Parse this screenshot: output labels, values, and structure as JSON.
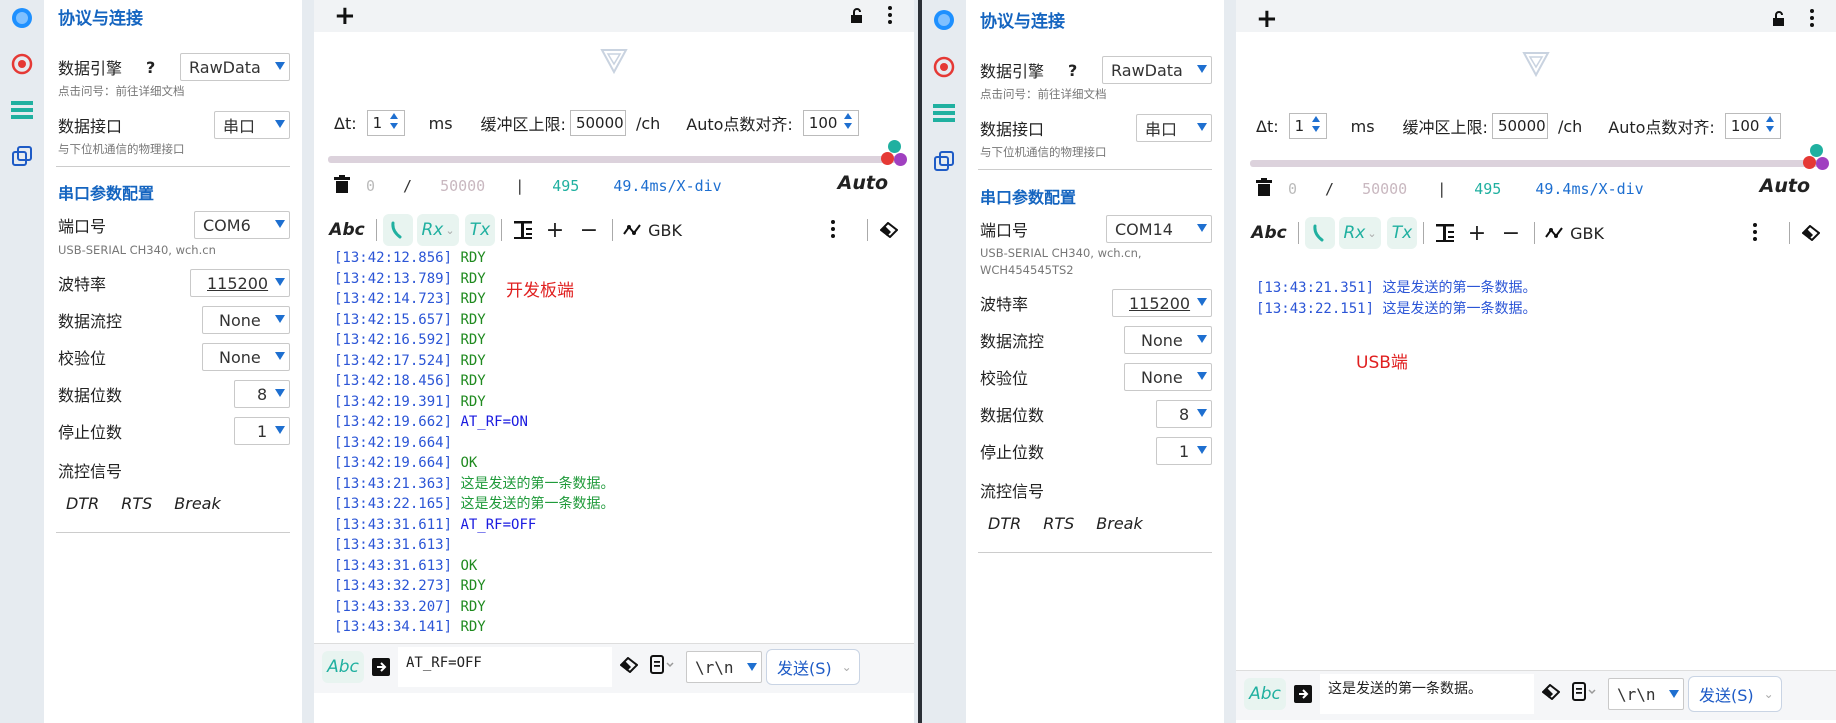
{
  "left": {
    "panel": {
      "section_title": "协议与连接",
      "engine_label": "数据引擎",
      "engine_help": "?",
      "engine_value": "RawData",
      "engine_hint": "点击问号：前往详细文档",
      "iface_label": "数据接口",
      "iface_value": "串口",
      "iface_hint": "与下位机通信的物理接口",
      "serial_title": "串口参数配置",
      "port_label": "端口号",
      "port_value": "COM6",
      "port_hint": "USB-SERIAL CH340, wch.cn",
      "baud_label": "波特率",
      "baud_value": "115200",
      "flow_label": "数据流控",
      "flow_value": "None",
      "parity_label": "校验位",
      "parity_value": "None",
      "databits_label": "数据位数",
      "databits_value": "8",
      "stopbits_label": "停止位数",
      "stopbits_value": "1",
      "flowsig_label": "流控信号",
      "dtr": "DTR",
      "rts": "RTS",
      "brk": "Break"
    },
    "main": {
      "add": "+",
      "dt_label": "Δt:",
      "dt_value": "1",
      "dt_unit": "ms",
      "buf_label": "缓冲区上限:",
      "buf_value": "50000",
      "buf_unit": "/ch",
      "align_label": "Auto点数对齐:",
      "align_value": "100",
      "stat_count": "0",
      "stat_slash": "/",
      "stat_max": "50000",
      "stat_bar": "|",
      "stat_n": "495",
      "stat_div": "49.4ms/X-div",
      "auto": "Auto",
      "tb_abc": "Abc",
      "tb_rx": "Rx",
      "tb_tx": "Tx",
      "tb_plus": "+",
      "tb_minus": "−",
      "tb_enc": "GBK",
      "annotation": "开发板端",
      "log": [
        {
          "t": "[13:42:12.856]",
          "m": "RDY",
          "c": "tx-green"
        },
        {
          "t": "[13:42:13.789]",
          "m": "RDY",
          "c": "tx-green"
        },
        {
          "t": "[13:42:14.723]",
          "m": "RDY",
          "c": "tx-green"
        },
        {
          "t": "[13:42:15.657]",
          "m": "RDY",
          "c": "tx-green"
        },
        {
          "t": "[13:42:16.592]",
          "m": "RDY",
          "c": "tx-green"
        },
        {
          "t": "[13:42:17.524]",
          "m": "RDY",
          "c": "tx-green"
        },
        {
          "t": "[13:42:18.456]",
          "m": "RDY",
          "c": "tx-green"
        },
        {
          "t": "[13:42:19.391]",
          "m": "RDY",
          "c": "tx-green"
        },
        {
          "t": "[13:42:19.662]",
          "m": "AT_RF=ON",
          "c": "tx-blue"
        },
        {
          "t": "[13:42:19.664]",
          "m": "",
          "c": "tx-green"
        },
        {
          "t": "[13:42:19.664]",
          "m": "OK",
          "c": "tx-green"
        },
        {
          "t": "[13:43:21.363]",
          "m": "这是发送的第一条数据。",
          "c": "tx-cn-green"
        },
        {
          "t": "[13:43:22.165]",
          "m": "这是发送的第一条数据。",
          "c": "tx-cn-green"
        },
        {
          "t": "[13:43:31.611]",
          "m": "AT_RF=OFF",
          "c": "tx-blue"
        },
        {
          "t": "[13:43:31.613]",
          "m": "",
          "c": "tx-green"
        },
        {
          "t": "[13:43:31.613]",
          "m": "OK",
          "c": "tx-green"
        },
        {
          "t": "[13:43:32.273]",
          "m": "RDY",
          "c": "tx-green"
        },
        {
          "t": "[13:43:33.207]",
          "m": "RDY",
          "c": "tx-green"
        },
        {
          "t": "[13:43:34.141]",
          "m": "RDY",
          "c": "tx-green"
        }
      ],
      "send_mode": "Abc",
      "send_text": "AT_RF=OFF",
      "line_end": "\\r\\n",
      "send_label": "发送(S)"
    }
  },
  "right": {
    "panel": {
      "section_title": "协议与连接",
      "engine_label": "数据引擎",
      "engine_help": "?",
      "engine_value": "RawData",
      "engine_hint": "点击问号：前往详细文档",
      "iface_label": "数据接口",
      "iface_value": "串口",
      "iface_hint": "与下位机通信的物理接口",
      "serial_title": "串口参数配置",
      "port_label": "端口号",
      "port_value": "COM14",
      "port_hint": "USB-SERIAL CH340, wch.cn,",
      "port_hint2": "WCH454545TS2",
      "baud_label": "波特率",
      "baud_value": "115200",
      "flow_label": "数据流控",
      "flow_value": "None",
      "parity_label": "校验位",
      "parity_value": "None",
      "databits_label": "数据位数",
      "databits_value": "8",
      "stopbits_label": "停止位数",
      "stopbits_value": "1",
      "flowsig_label": "流控信号",
      "dtr": "DTR",
      "rts": "RTS",
      "brk": "Break"
    },
    "main": {
      "add": "+",
      "dt_label": "Δt:",
      "dt_value": "1",
      "dt_unit": "ms",
      "buf_label": "缓冲区上限:",
      "buf_value": "50000",
      "buf_unit": "/ch",
      "align_label": "Auto点数对齐:",
      "align_value": "100",
      "stat_count": "0",
      "stat_slash": "/",
      "stat_max": "50000",
      "stat_bar": "|",
      "stat_n": "495",
      "stat_div": "49.4ms/X-div",
      "auto": "Auto",
      "tb_abc": "Abc",
      "tb_rx": "Rx",
      "tb_tx": "Tx",
      "tb_plus": "+",
      "tb_minus": "−",
      "tb_enc": "GBK",
      "annotation": "USB端",
      "log": [
        {
          "t": "[13:43:21.351]",
          "m": "这是发送的第一条数据。",
          "c": "tx-cn-blue"
        },
        {
          "t": "[13:43:22.151]",
          "m": "这是发送的第一条数据。",
          "c": "tx-cn-blue"
        }
      ],
      "send_mode": "Abc",
      "send_text": "这是发送的第一条数据。",
      "line_end": "\\r\\n",
      "send_label": "发送(S)"
    }
  },
  "colors": {
    "accent": "#1565c0",
    "rx_green": "#1f8a1f",
    "tx_blue": "#1a1ae0",
    "timestamp": "#2b55d6",
    "annotation_red": "#e02020",
    "teal": "#20b0a0"
  },
  "icons": [
    "add-icon",
    "lock-open-icon",
    "more-vert-icon",
    "logo-icon",
    "trash-icon",
    "clock-icon",
    "rx-icon",
    "tx-icon",
    "text-format-icon",
    "plus-icon",
    "minus-icon",
    "waveform-icon",
    "eraser-icon",
    "send-file-icon",
    "history-icon",
    "connect-icon",
    "record-icon",
    "list-icon",
    "windows-icon"
  ]
}
